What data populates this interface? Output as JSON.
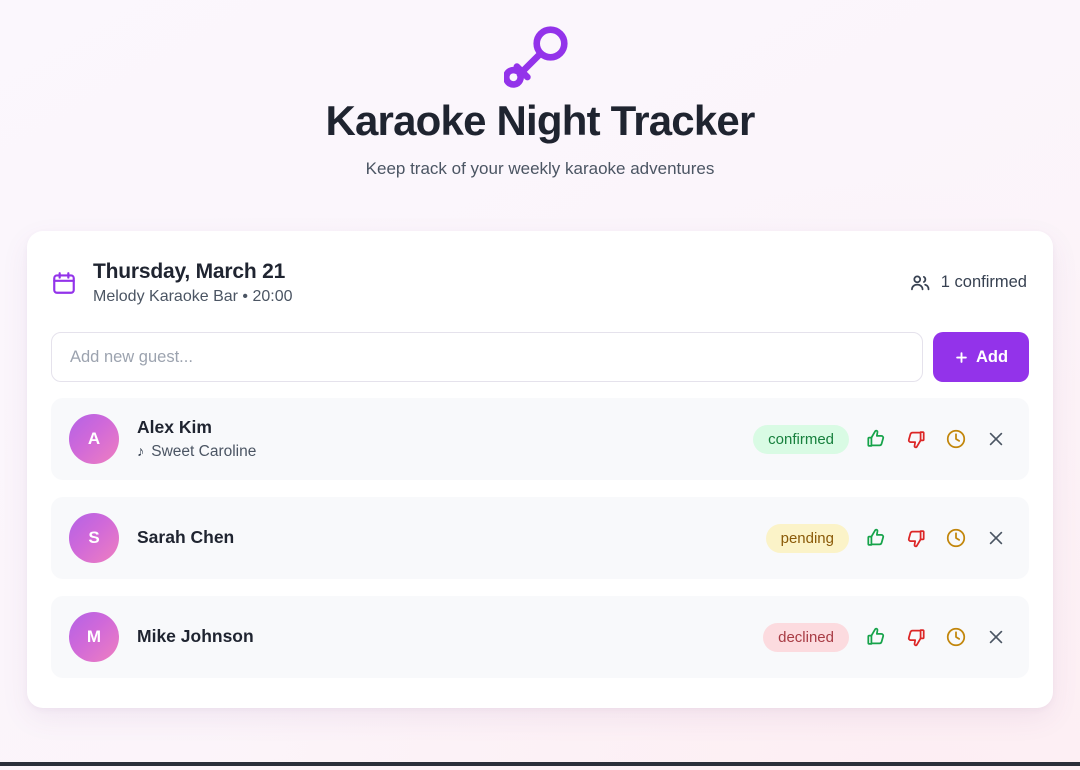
{
  "header": {
    "icon": "microphone-icon",
    "title": "Karaoke Night Tracker",
    "subtitle": "Keep track of your weekly karaoke adventures",
    "accent_color": "#9333ea"
  },
  "event": {
    "icon": "calendar-icon",
    "date": "Thursday, March 21",
    "meta": "Melody Karaoke Bar • 20:00",
    "venue": "Melody Karaoke Bar",
    "time": "20:00",
    "confirmed_icon": "users-icon",
    "confirmed_label": "1 confirmed",
    "confirmed_count": 1
  },
  "add_guest": {
    "placeholder": "Add new guest...",
    "value": "",
    "button_label": "Add",
    "button_icon": "plus-icon",
    "button_color": "#9333ea"
  },
  "actions": {
    "approve_icon": "thumbs-up-icon",
    "decline_icon": "thumbs-down-icon",
    "pending_icon": "clock-icon",
    "remove_icon": "close-icon",
    "approve_color": "#16a34a",
    "decline_color": "#dc2626",
    "pending_color": "#c2860b",
    "remove_color": "#4b5563"
  },
  "guests": [
    {
      "initial": "A",
      "name": "Alex Kim",
      "song": "Sweet Caroline",
      "song_icon": "music-note-icon",
      "status": "confirmed",
      "status_class": "confirmed"
    },
    {
      "initial": "S",
      "name": "Sarah Chen",
      "song": "",
      "song_icon": "",
      "status": "pending",
      "status_class": "pending"
    },
    {
      "initial": "M",
      "name": "Mike Johnson",
      "song": "",
      "song_icon": "",
      "status": "declined",
      "status_class": "declined"
    }
  ]
}
